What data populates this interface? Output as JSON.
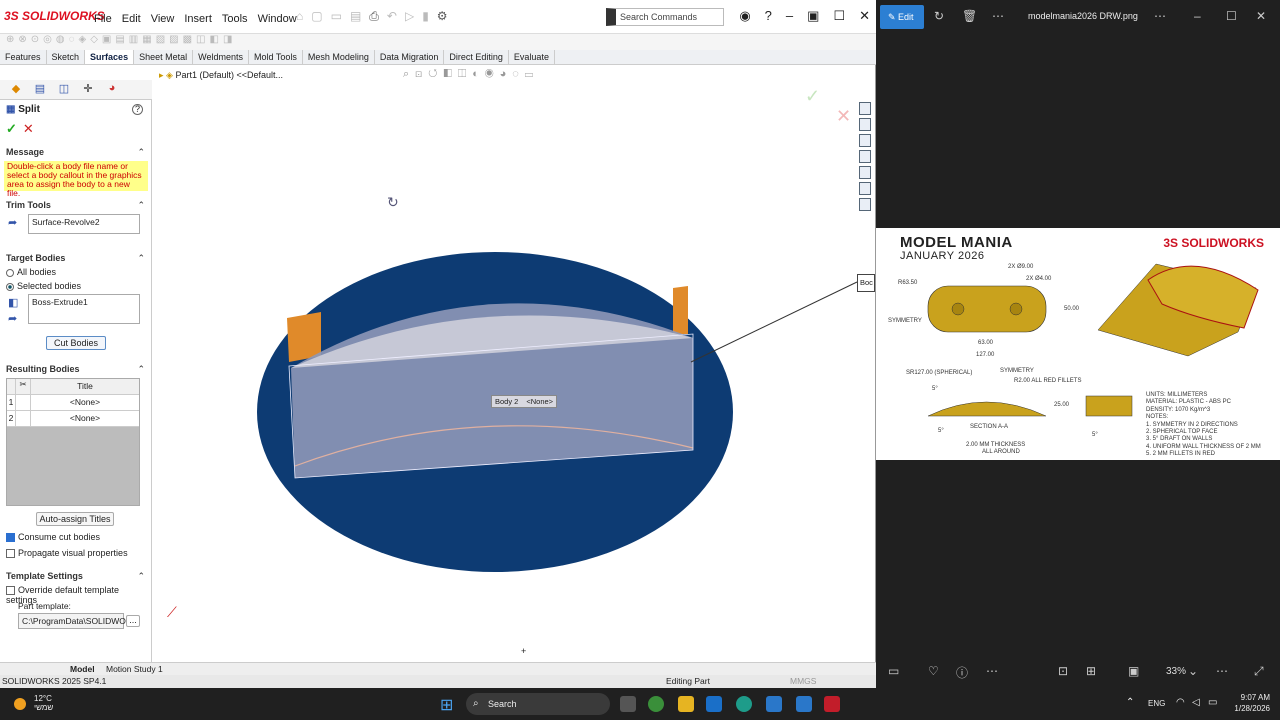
{
  "sw": {
    "logo": "3S SOLIDWORKS",
    "menu": [
      "File",
      "Edit",
      "View",
      "Insert",
      "Tools",
      "Window"
    ],
    "search_placeholder": "Search Commands",
    "tabs": [
      "Features",
      "Sketch",
      "Surfaces",
      "Sheet Metal",
      "Weldments",
      "Mold Tools",
      "Mesh Modeling",
      "Data Migration",
      "Direct Editing",
      "Evaluate"
    ],
    "active_tab": "Surfaces",
    "tree_label": "Part1 (Default) <<Default...",
    "pm": {
      "title": "Split",
      "message_header": "Message",
      "message": "Double-click a body file name or select a body callout in the graphics area to assign the body to a new file.",
      "trim_header": "Trim Tools",
      "trim_value": "Surface-Revolve2",
      "target_header": "Target Bodies",
      "all_bodies": "All bodies",
      "selected_bodies": "Selected bodies",
      "target_value": "Boss-Extrude1",
      "cut_button": "Cut Bodies",
      "resulting_header": "Resulting Bodies",
      "col_title": "Title",
      "rows": [
        {
          "n": "1",
          "title": "<None>"
        },
        {
          "n": "2",
          "title": "<None>"
        }
      ],
      "auto_assign": "Auto-assign Titles",
      "consume": "Consume cut bodies",
      "propagate": "Propagate visual properties",
      "template_header": "Template Settings",
      "override": "Override default template settings",
      "part_template": "Part template:",
      "template_path": "C:\\ProgramData\\SOLIDWORK",
      "browse": "..."
    },
    "callout": {
      "body": "Body 2",
      "value": "<None>"
    },
    "callout_right": "Boc",
    "bottom_tabs": [
      "Model",
      "Motion Study 1"
    ],
    "status": {
      "version": "SOLIDWORKS 2025 SP4.1",
      "mode": "Editing Part",
      "units": "MMGS"
    }
  },
  "viewer": {
    "edit": "Edit",
    "filename": "modelmania2026 DRW.png",
    "zoom": "33%",
    "poster": {
      "title": "MODEL MANIA",
      "date": "JANUARY 2026",
      "brand": "3S SOLIDWORKS",
      "dims": [
        "R63.50",
        "2X Ø9.00",
        "2X Ø4.00",
        "SYMMETRY",
        "50.00",
        "63.00",
        "127.00",
        "SR127.00 (SPHERICAL)",
        "SYMMETRY",
        "R2.00 ALL RED FILLETS",
        "25.00",
        "5°",
        "5°",
        "SECTION A-A",
        "2.00 MM THICKNESS",
        "ALL AROUND",
        "5°"
      ],
      "notes": [
        "UNITS: MILLIMETERS",
        "MATERIAL: PLASTIC - ABS PC",
        "DENSITY: 1070 Kg/m^3",
        "NOTES:",
        "1. SYMMETRY IN 2 DIRECTIONS",
        "2. SPHERICAL TOP FACE",
        "3. 5° DRAFT ON WALLS",
        "4. UNIFORM WALL THICKNESS OF 2 MM",
        "5. 2 MM FILLETS IN RED"
      ]
    }
  },
  "taskbar": {
    "temp": "12°C",
    "weather": "שמשי",
    "search": "Search",
    "lang": "ENG",
    "time": "9:07 AM",
    "date": "1/28/2026"
  },
  "colors": {
    "accent": "#2c7fd3",
    "disk": "#0d3b73",
    "brand": "#cc1122"
  }
}
